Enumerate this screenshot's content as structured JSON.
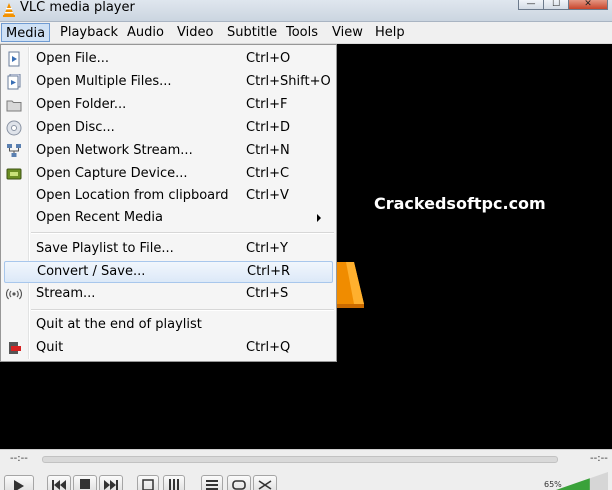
{
  "window": {
    "title": "VLC media player",
    "minimize_glyph": "—",
    "maximize_glyph": "☐",
    "close_glyph": "✕"
  },
  "menubar": {
    "items": [
      {
        "label": "Media",
        "active": true
      },
      {
        "label": "Playback"
      },
      {
        "label": "Audio"
      },
      {
        "label": "Video"
      },
      {
        "label": "Subtitle"
      },
      {
        "label": "Tools"
      },
      {
        "label": "View"
      },
      {
        "label": "Help"
      }
    ]
  },
  "media_menu": {
    "items": [
      {
        "label": "Open File...",
        "shortcut": "Ctrl+O",
        "icon": "file-icon"
      },
      {
        "label": "Open Multiple Files...",
        "shortcut": "Ctrl+Shift+O",
        "icon": "files-icon"
      },
      {
        "label": "Open Folder...",
        "shortcut": "Ctrl+F",
        "icon": "folder-icon"
      },
      {
        "label": "Open Disc...",
        "shortcut": "Ctrl+D",
        "icon": "disc-icon"
      },
      {
        "label": "Open Network Stream...",
        "shortcut": "Ctrl+N",
        "icon": "network-icon"
      },
      {
        "label": "Open Capture Device...",
        "shortcut": "Ctrl+C",
        "icon": "capture-icon"
      },
      {
        "label": "Open Location from clipboard",
        "shortcut": "Ctrl+V"
      },
      {
        "label": "Open Recent Media",
        "shortcut": ""
      },
      {
        "label": "Save Playlist to File...",
        "shortcut": "Ctrl+Y"
      },
      {
        "label": "Convert / Save...",
        "shortcut": "Ctrl+R",
        "highlighted": true
      },
      {
        "label": "Stream...",
        "shortcut": "Ctrl+S",
        "icon": "stream-icon"
      },
      {
        "label": "Quit at the end of playlist",
        "shortcut": ""
      },
      {
        "label": "Quit",
        "shortcut": "Ctrl+Q",
        "icon": "quit-icon"
      }
    ]
  },
  "video": {
    "watermark": "Crackedsoftpc.com"
  },
  "controls": {
    "elapsed": "--:--",
    "remaining": "--:--",
    "volume_percent": "65%",
    "volume_level": 0.65
  },
  "colors": {
    "menu_highlight": "#dce9f8",
    "menubar_active": "#cfe1f5",
    "vlc_orange": "#f39200"
  }
}
